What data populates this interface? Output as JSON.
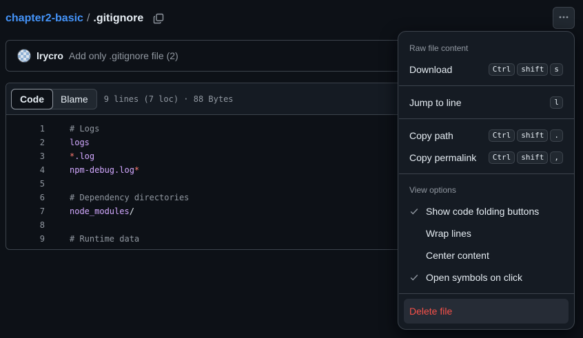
{
  "breadcrumb": {
    "repo": "chapter2-basic",
    "separator": "/",
    "file": ".gitignore"
  },
  "commit": {
    "author": "lrycro",
    "message": "Add only .gitignore file (2)"
  },
  "file_header": {
    "tab_code": "Code",
    "tab_blame": "Blame",
    "meta": "9 lines (7 loc) · 88 Bytes"
  },
  "code_lines": [
    {
      "n": "1",
      "t": "# Logs"
    },
    {
      "n": "2",
      "t": "logs"
    },
    {
      "n": "3",
      "a": "*",
      "b": ".log"
    },
    {
      "n": "4",
      "a": "npm-debug.log",
      "b": "*"
    },
    {
      "n": "5",
      "t": ""
    },
    {
      "n": "6",
      "t": "# Dependency directories"
    },
    {
      "n": "7",
      "a": "node_modules",
      "b": "/"
    },
    {
      "n": "8",
      "t": ""
    },
    {
      "n": "9",
      "t": "# Runtime data"
    }
  ],
  "menu": {
    "group_raw": "Raw file content",
    "download": "Download",
    "download_keys": [
      "Ctrl",
      "shift",
      "s"
    ],
    "jump": "Jump to line",
    "jump_key": "l",
    "copy_path": "Copy path",
    "copy_path_keys": [
      "Ctrl",
      "shift",
      "."
    ],
    "copy_permalink": "Copy permalink",
    "copy_permalink_keys": [
      "Ctrl",
      "shift",
      ","
    ],
    "group_view": "View options",
    "opt_folding": "Show code folding buttons",
    "opt_wrap": "Wrap lines",
    "opt_center": "Center content",
    "opt_symbols": "Open symbols on click",
    "delete": "Delete file"
  },
  "colors": {
    "accent": "#4493f8",
    "danger": "#f85149",
    "background": "#0d1117"
  }
}
